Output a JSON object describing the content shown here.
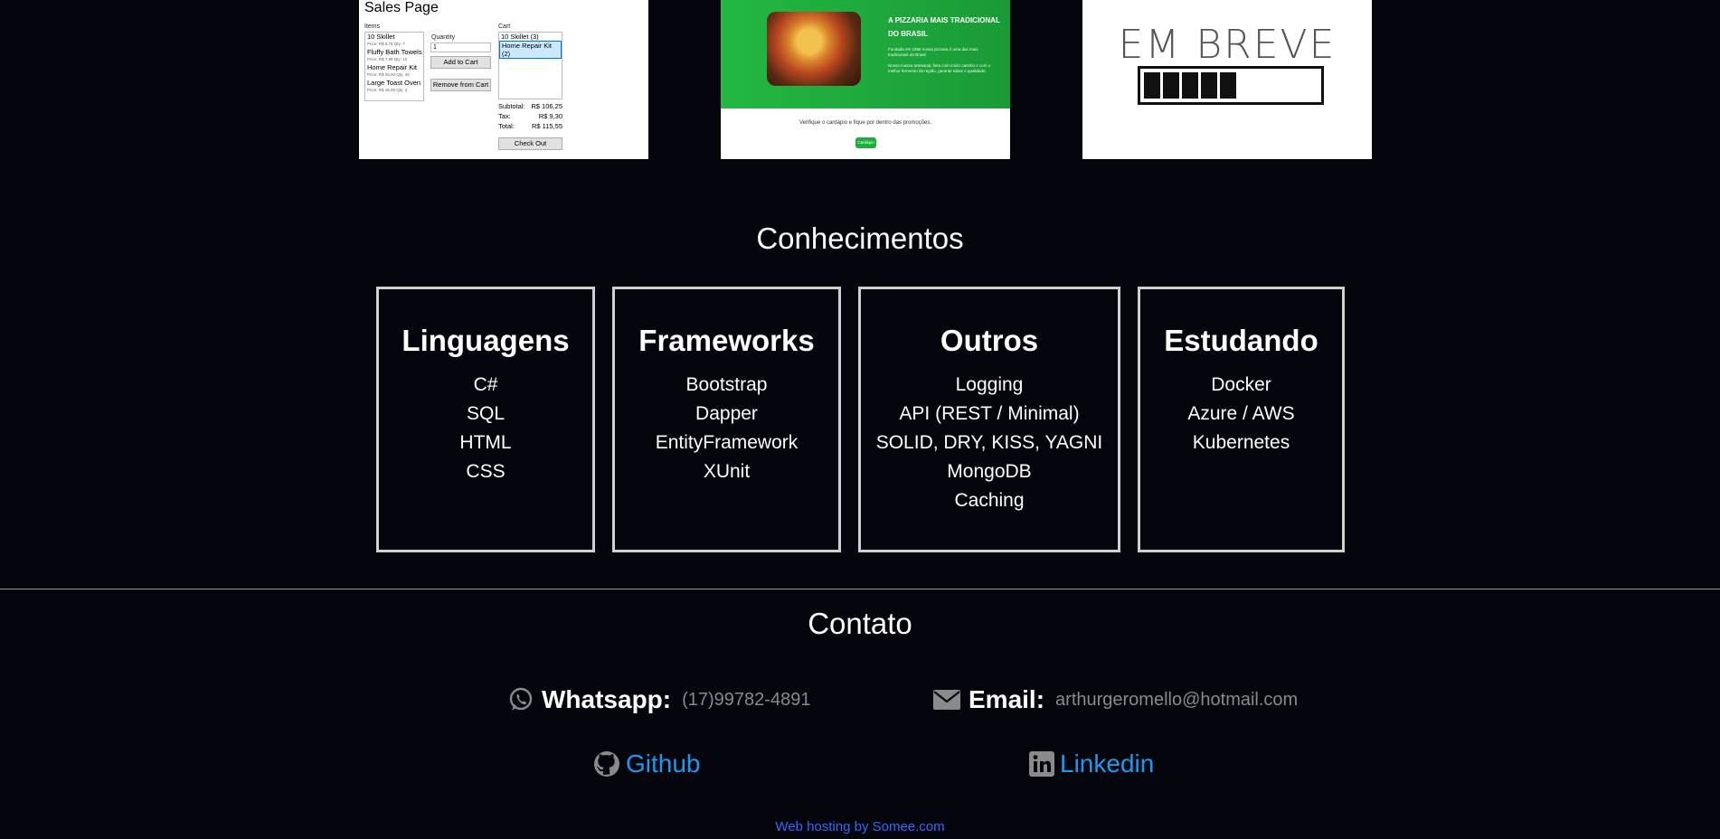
{
  "projects": {
    "sales": {
      "title": "Sales Page",
      "items_label": "Items",
      "items": [
        {
          "name": "10 Skillet",
          "detail": "Price: R$ 8,75  Qty: 7"
        },
        {
          "name": "Fluffy Bath Towels",
          "detail": "Price: R$ 7,99  Qty: 10"
        },
        {
          "name": "Home Repair Kit",
          "detail": "Price: R$ 25,00  Qty: 48"
        },
        {
          "name": "Large Toast Oven",
          "detail": "Price: R$ 48,00  Qty: 3"
        }
      ],
      "quantity_label": "Quantity",
      "quantity_value": "1",
      "add_button": "Add to Cart",
      "remove_button": "Remove from Cart",
      "cart_label": "Cart",
      "cart": [
        "10 Skillet (3)",
        "Home Repair Kit (2)"
      ],
      "subtotal_label": "Subtotal:",
      "subtotal": "R$ 106,25",
      "tax_label": "Tax:",
      "tax": "R$ 9,30",
      "total_label": "Total:",
      "total": "R$ 115,55",
      "checkout_button": "Check Out"
    },
    "pizza": {
      "heading": "A PIZZARIA MAIS TRADICIONAL DO BRASIL",
      "text1": "Fundada em 1986 nossa pizzaria é uma das mais tradicionais do Brasil.",
      "text2": "Nossa massa artesanal, feita com muito carinho e com o melhor fermento da região, garante sabor e qualidade.",
      "cta": "Verifique o cardápio e fique por dentro das promoções.",
      "button": "Cardápio"
    },
    "soon": {
      "text": "EM BREVE",
      "progress_filled": 5,
      "progress_total": 10
    }
  },
  "knowledge": {
    "title": "Conhecimentos",
    "cards": [
      {
        "title": "Linguagens",
        "items": [
          "C#",
          "SQL",
          "HTML",
          "CSS"
        ]
      },
      {
        "title": "Frameworks",
        "items": [
          "Bootstrap",
          "Dapper",
          "EntityFramework",
          "XUnit"
        ]
      },
      {
        "title": "Outros",
        "items": [
          "Logging",
          "API (REST / Minimal)",
          "SOLID, DRY, KISS, YAGNI",
          "MongoDB",
          "Caching"
        ]
      },
      {
        "title": "Estudando",
        "items": [
          "Docker",
          "Azure / AWS",
          "Kubernetes"
        ]
      }
    ]
  },
  "contact": {
    "title": "Contato",
    "whatsapp_label": "Whatsapp:",
    "whatsapp_value": "(17)99782-4891",
    "email_label": "Email:",
    "email_value": "arthurgeromello@hotmail.com",
    "github": "Github",
    "linkedin": "Linkedin"
  },
  "footer": {
    "hosting": "Web hosting by Somee.com"
  },
  "colors": {
    "background": "#03040c",
    "link": "#1a9bef",
    "hosting_link": "#2f6bff",
    "card_border": "#cfcfcf"
  },
  "icons": {
    "whatsapp": "whatsapp-icon",
    "email": "envelope-icon",
    "github": "github-icon",
    "linkedin": "linkedin-icon"
  }
}
